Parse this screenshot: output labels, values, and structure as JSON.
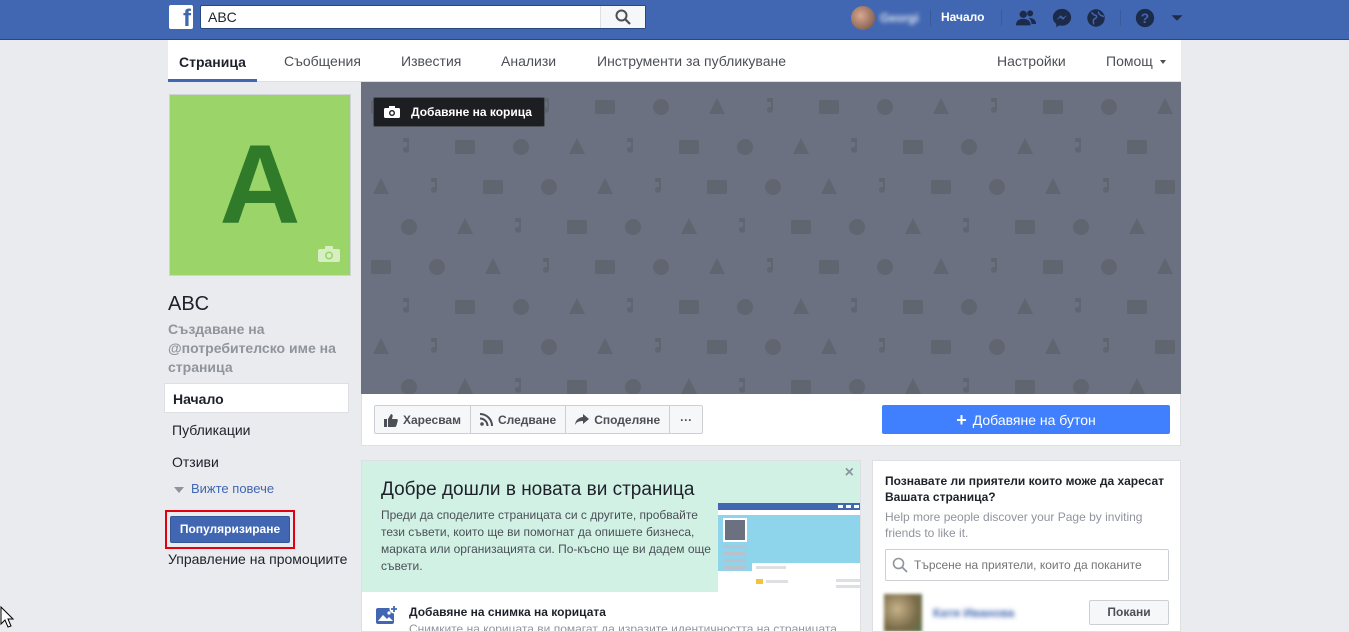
{
  "topbar": {
    "search_value": "ABC",
    "user_name": "Georgi",
    "home_label": "Начало"
  },
  "tabs": [
    {
      "label": "Страница"
    },
    {
      "label": "Съобщения"
    },
    {
      "label": "Известия"
    },
    {
      "label": "Анализи"
    },
    {
      "label": "Инструменти за публикуване"
    },
    {
      "label": "Настройки"
    },
    {
      "label": "Помощ"
    }
  ],
  "page": {
    "avatar_letter": "A",
    "name": "ABC",
    "handle_prompt": "Създаване на @потребителско име на страница"
  },
  "leftnav": {
    "items": [
      {
        "label": "Начало"
      },
      {
        "label": "Публикации"
      },
      {
        "label": "Отзиви"
      }
    ],
    "see_more": "Вижте повече",
    "promote": "Популяризиране",
    "manage_promotions": "Управление на промоциите"
  },
  "cover": {
    "add_cover_label": "Добавяне на корица"
  },
  "actions": {
    "like": "Харесвам",
    "follow": "Следване",
    "share": "Споделяне",
    "more": "···",
    "add_button": "Добавяне на бутон"
  },
  "welcome": {
    "title": "Добре дошли в новата ви страница",
    "description": "Преди да споделите страницата си с другите, пробвайте тези съвети, които ще ви помогнат да опишете бизнеса, марката или организацията си. По-късно ще ви дадем още съвети.",
    "close": "×",
    "tip_title": "Добавяне на снимка на корицата",
    "tip_desc": "Снимките на корицата ви помагат да изразите идентичността на страницата"
  },
  "invite": {
    "title": "Познавате ли приятели които може да харесат Вашата страница?",
    "subtitle": "Help more people discover your Page by inviting friends to like it.",
    "search_placeholder": "Търсене на приятели, които да поканите",
    "friend_name": "Катя Иванова",
    "invite_label": "Покани"
  },
  "colors": {
    "brand": "#4267b2",
    "accent_button": "#4080ff",
    "cover_bg": "#6b7180",
    "avatar_bg": "#9bd56a",
    "avatar_letter": "#2f7b2a",
    "welcome_bg": "#d2f1e5",
    "highlight_frame": "#e00010"
  }
}
